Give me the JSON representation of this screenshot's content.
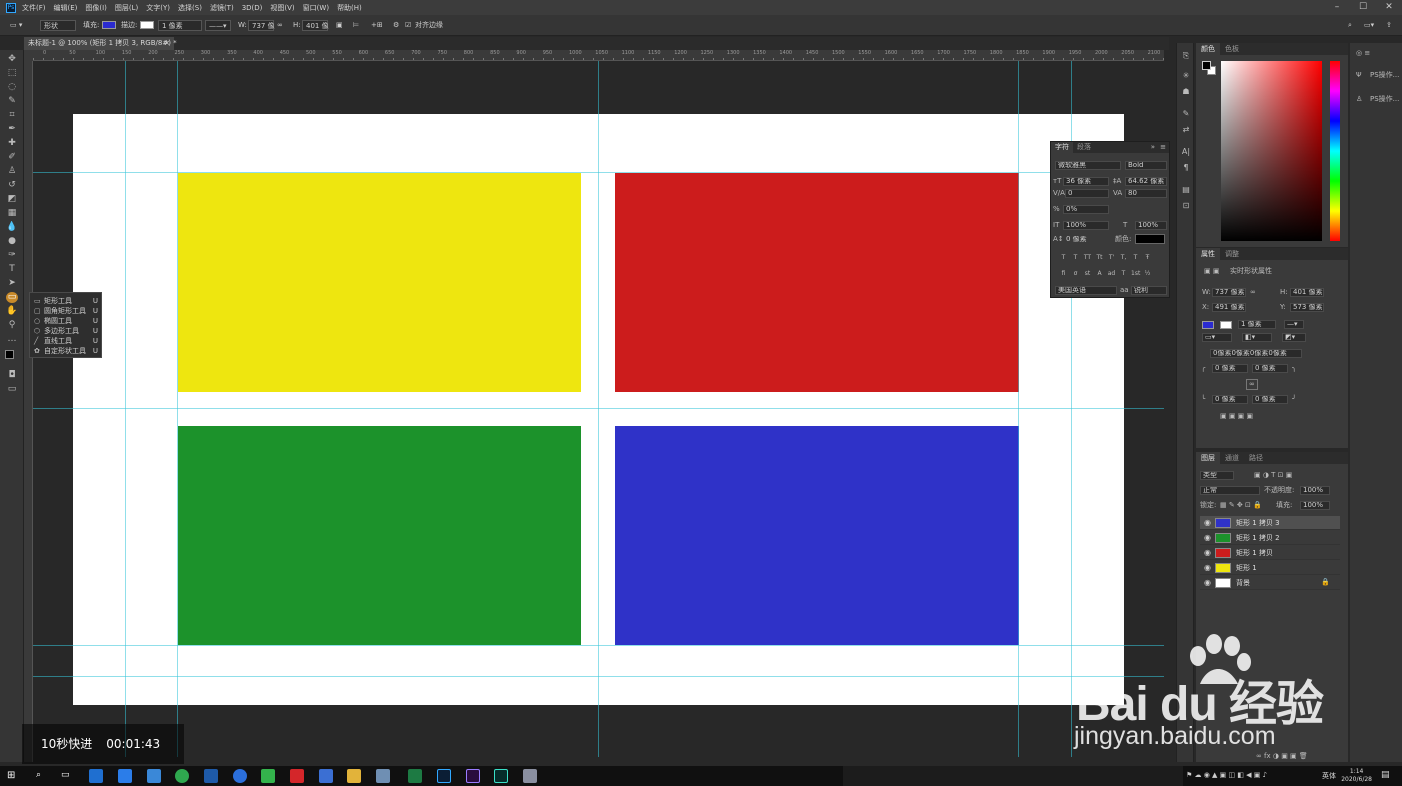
{
  "menubar": {
    "items": [
      "文件(F)",
      "编辑(E)",
      "图像(I)",
      "图层(L)",
      "文字(Y)",
      "选择(S)",
      "滤镜(T)",
      "3D(D)",
      "视图(V)",
      "窗口(W)",
      "帮助(H)"
    ]
  },
  "optionsbar": {
    "mode": "形状",
    "fill_label": "填充:",
    "stroke_label": "描边:",
    "stroke_width": "1 像素",
    "w_label": "W:",
    "w_value": "737 像",
    "h_label": "H:",
    "h_value": "401 像",
    "align_edges": "对齐边缘",
    "fill_color": "#2b2bd0"
  },
  "document": {
    "tab_title": "未标题-1 @ 100% (矩形 1 拷贝 3, RGB/8#) *",
    "ruler_ticks": [
      "0",
      "50",
      "100",
      "150",
      "200",
      "250",
      "300",
      "350",
      "400",
      "450",
      "500",
      "550",
      "600",
      "650",
      "700",
      "750",
      "800",
      "850",
      "900",
      "950",
      "1000",
      "1050",
      "1100",
      "1150",
      "1200",
      "1250",
      "1300",
      "1350",
      "1400",
      "1450",
      "1500",
      "1550",
      "1600",
      "1650",
      "1700",
      "1750",
      "1800",
      "1850",
      "1900",
      "1950",
      "2000",
      "2050",
      "2100"
    ],
    "rect_colors": {
      "yellow": "#eee60f",
      "red": "#cc1c1c",
      "green": "#1c922b",
      "blue": "#2f32c8"
    }
  },
  "flyout": {
    "items": [
      {
        "label": "矩形工具",
        "key": "U"
      },
      {
        "label": "圆角矩形工具",
        "key": "U"
      },
      {
        "label": "椭圆工具",
        "key": "U"
      },
      {
        "label": "多边形工具",
        "key": "U"
      },
      {
        "label": "直线工具",
        "key": "U"
      },
      {
        "label": "自定形状工具",
        "key": "U"
      }
    ]
  },
  "character_panel": {
    "tabs": [
      "字符",
      "段落"
    ],
    "font_family": "微软雅黑",
    "font_style": "Bold",
    "font_size": "36 像素",
    "leading": "64.62 像素",
    "kerning": "0",
    "tracking": "80",
    "scale_percent": "0%",
    "vertical_scale": "100%",
    "horizontal_scale": "100%",
    "baseline_shift": "0 像素",
    "color_label": "颜色:",
    "language": "美国英语",
    "aa_label": "aa",
    "antialias": "锐利"
  },
  "color_panel": {
    "tabs": [
      "颜色",
      "色板"
    ]
  },
  "properties_panel": {
    "tabs": [
      "属性",
      "调整"
    ],
    "title": "实时形状属性",
    "w_label": "W:",
    "w_value": "737 像素",
    "h_label": "H:",
    "h_value": "401 像素",
    "x_label": "X:",
    "x_value": "491 像素",
    "y_label": "Y:",
    "y_value": "573 像素",
    "stroke_width": "1 像素",
    "corner_summary": "0像素0像素0像素0像素",
    "corner_tl": "0 像素",
    "corner_tr": "0 像素",
    "corner_bl": "0 像素",
    "corner_br": "0 像素"
  },
  "layers_panel": {
    "tabs": [
      "图层",
      "通道",
      "路径"
    ],
    "filter_kind": "类型",
    "blend_mode": "正常",
    "opacity_label": "不透明度:",
    "opacity": "100%",
    "lock_label": "锁定:",
    "fill_label": "填充:",
    "fill": "100%",
    "layers": [
      {
        "name": "矩形 1 拷贝 3",
        "thumb": "#2f32c8",
        "selected": true
      },
      {
        "name": "矩形 1 拷贝 2",
        "thumb": "#1c922b",
        "selected": false
      },
      {
        "name": "矩形 1 拷贝",
        "thumb": "#cc1c1c",
        "selected": false
      },
      {
        "name": "矩形 1",
        "thumb": "#eee60f",
        "selected": false
      },
      {
        "name": "背景",
        "thumb": "#ffffff",
        "selected": false
      }
    ]
  },
  "far_right": {
    "items": [
      "PS操作...",
      "PS操作..."
    ]
  },
  "overlay": {
    "label": "10秒快进",
    "time": "00:01:43"
  },
  "watermark": {
    "brand": "Bai  du 经验",
    "url": "jingyan.baidu.com"
  },
  "taskbar": {
    "lang": "英体",
    "time": "1:14",
    "date": "2020/6/28"
  }
}
